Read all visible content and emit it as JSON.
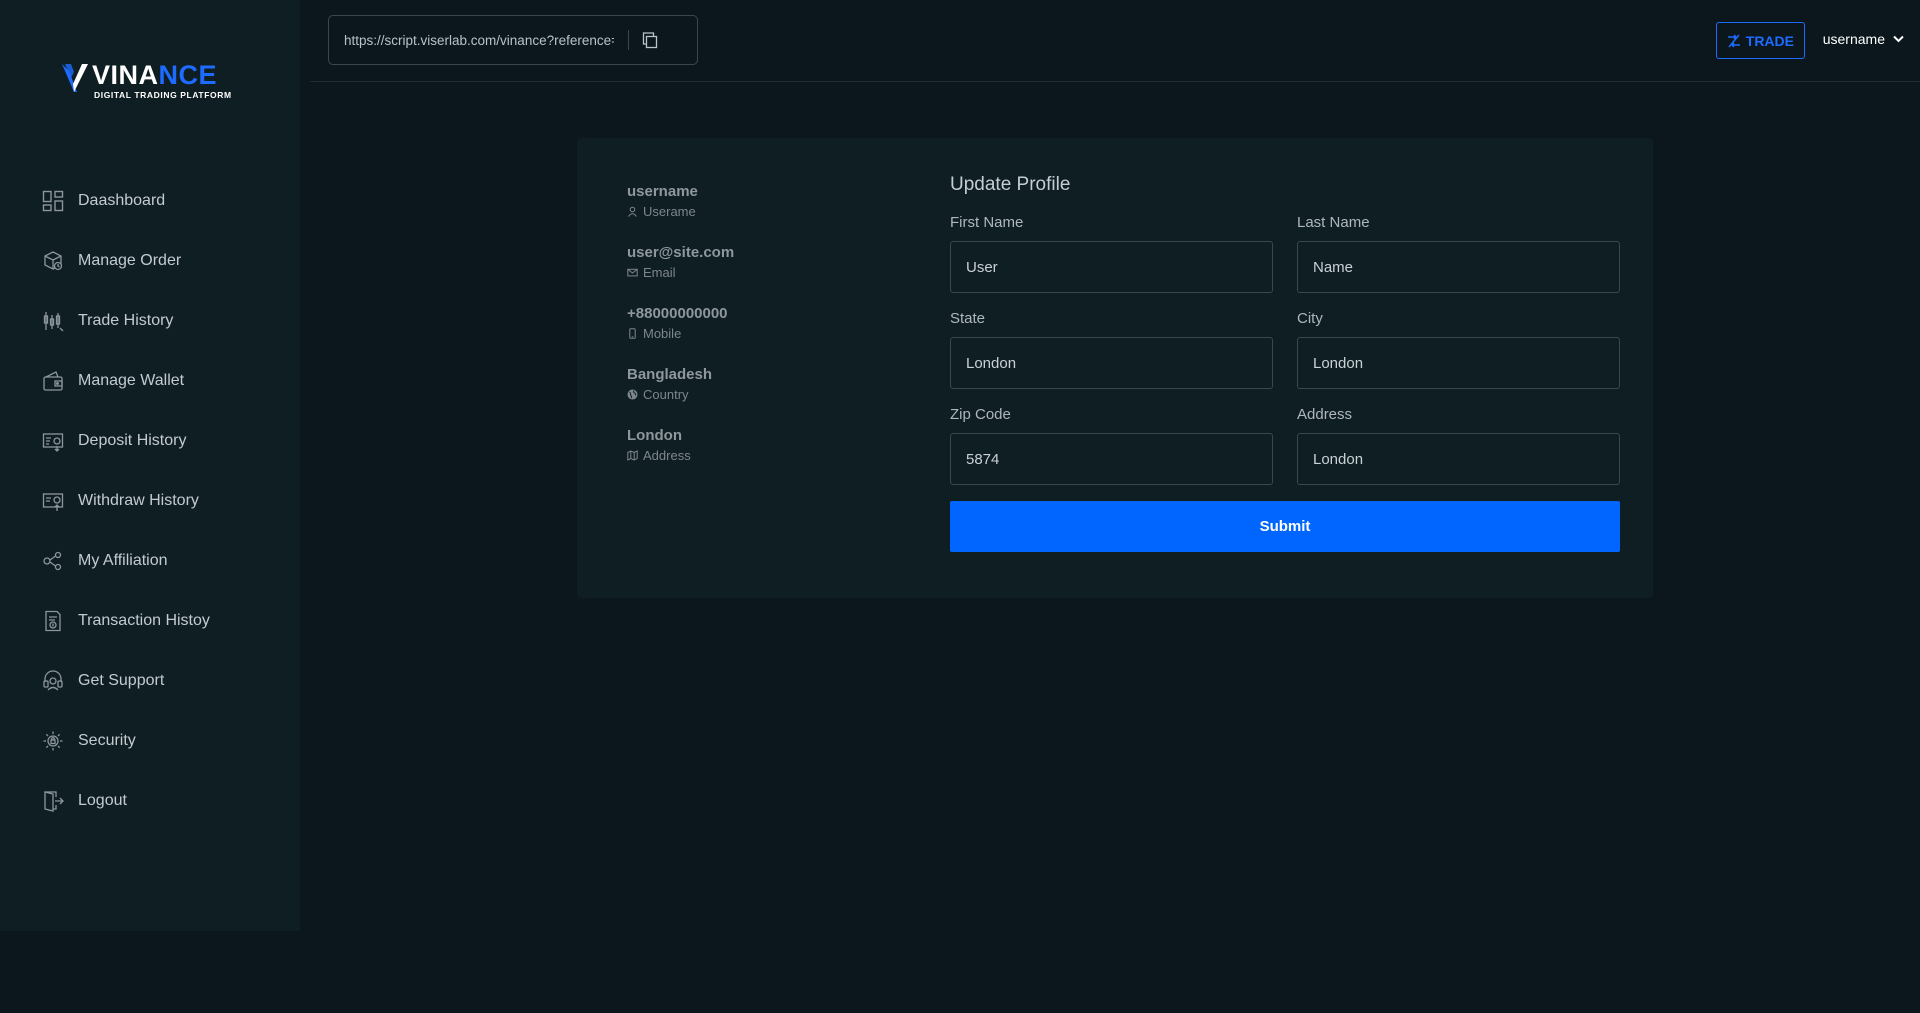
{
  "brand": {
    "name_part1": "VINA",
    "name_part2": "NCE",
    "tagline": "DIGITAL TRADING PLATFORM",
    "accent": "#1e6bff"
  },
  "sidebar": {
    "items": [
      {
        "label": "Daashboard",
        "icon": "dashboard-icon"
      },
      {
        "label": "Manage Order",
        "icon": "box-icon"
      },
      {
        "label": "Trade History",
        "icon": "candlestick-icon"
      },
      {
        "label": "Manage Wallet",
        "icon": "wallet-icon"
      },
      {
        "label": "Deposit History",
        "icon": "deposit-icon"
      },
      {
        "label": "Withdraw History",
        "icon": "withdraw-icon"
      },
      {
        "label": "My Affiliation",
        "icon": "affiliation-icon"
      },
      {
        "label": "Transaction Histoy",
        "icon": "transaction-icon"
      },
      {
        "label": "Get Support",
        "icon": "support-icon"
      },
      {
        "label": "Security",
        "icon": "security-icon"
      },
      {
        "label": "Logout",
        "icon": "logout-icon"
      }
    ]
  },
  "topbar": {
    "referral_url": "https://script.viserlab.com/vinance?reference=username",
    "trade_label": "TRADE",
    "username": "username"
  },
  "profile": {
    "username": {
      "value": "username",
      "label": "Userame"
    },
    "email": {
      "value": "user@site.com",
      "label": "Email"
    },
    "mobile": {
      "value": "+88000000000",
      "label": "Mobile"
    },
    "country": {
      "value": "Bangladesh",
      "label": "Country"
    },
    "address": {
      "value": "London",
      "label": "Address"
    }
  },
  "form": {
    "title": "Update Profile",
    "first_name": {
      "label": "First Name",
      "value": "User"
    },
    "last_name": {
      "label": "Last Name",
      "value": "Name"
    },
    "state": {
      "label": "State",
      "value": "London"
    },
    "city": {
      "label": "City",
      "value": "London"
    },
    "zip": {
      "label": "Zip Code",
      "value": "5874"
    },
    "address": {
      "label": "Address",
      "value": "London"
    },
    "submit_label": "Submit"
  }
}
